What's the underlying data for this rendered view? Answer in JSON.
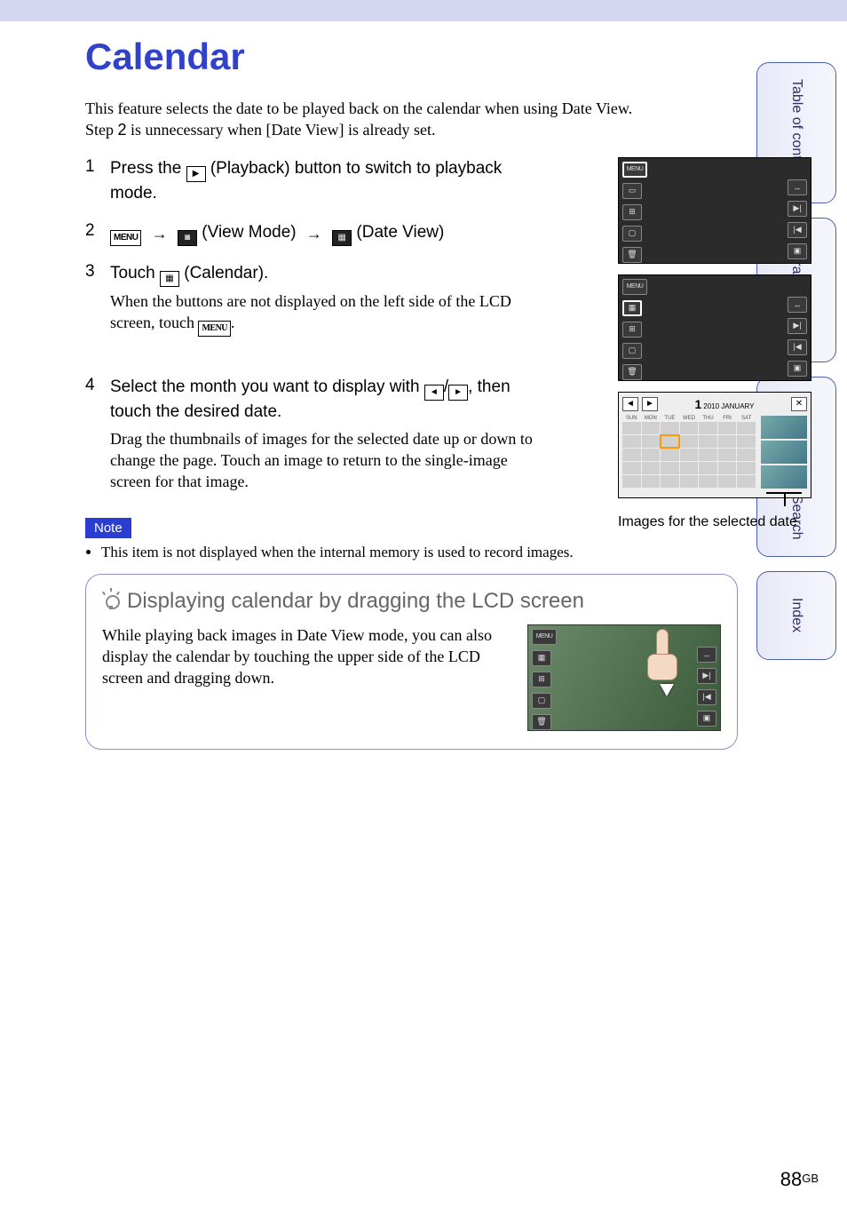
{
  "sideTabs": {
    "toc": "Table of contents",
    "op": "Operation Search",
    "menu": "MENU/Settings Search",
    "index": "Index"
  },
  "title": "Calendar",
  "intro": {
    "l1": "This feature selects the date to be played back on the calendar when using Date View.",
    "l2a": "Step ",
    "l2step": "2",
    "l2b": " is unnecessary when [Date View] is already set."
  },
  "steps": {
    "s1": {
      "head_a": "Press the ",
      "head_b": " (Playback) button to switch to playback mode."
    },
    "s2": {
      "icon_menu": "MENU",
      "txt_viewmode": " (View Mode) ",
      "txt_dateview": " (Date View)"
    },
    "s3": {
      "head_a": "Touch ",
      "head_b": " (Calendar).",
      "body_a": "When the buttons are not displayed on the left side of the LCD screen, touch ",
      "body_menu": "MENU",
      "body_b": "."
    },
    "s4": {
      "head_a": "Select the month you want to display with ",
      "head_b": ", then touch the desired date.",
      "body": "Drag the thumbnails of images for the selected date up or down to change the page. Touch an image to return to the single-image screen for that image."
    }
  },
  "figs": {
    "menuLabel": "MENU",
    "calendar": {
      "dayNum": "1",
      "monthYear": "2010 JANUARY",
      "weekdays": [
        "SUN",
        "MON",
        "TUE",
        "WED",
        "THU",
        "FRI",
        "SAT"
      ]
    },
    "caption": "Images for the selected date"
  },
  "note": {
    "tag": "Note",
    "item": "This item is not displayed when the internal memory is used to record images."
  },
  "tip": {
    "title": "Displaying calendar by dragging the LCD screen",
    "text": "While playing back images in Date View mode, you can also display the calendar by touching the upper side of the LCD screen and dragging down."
  },
  "page": {
    "num": "88",
    "suffix": "GB"
  }
}
